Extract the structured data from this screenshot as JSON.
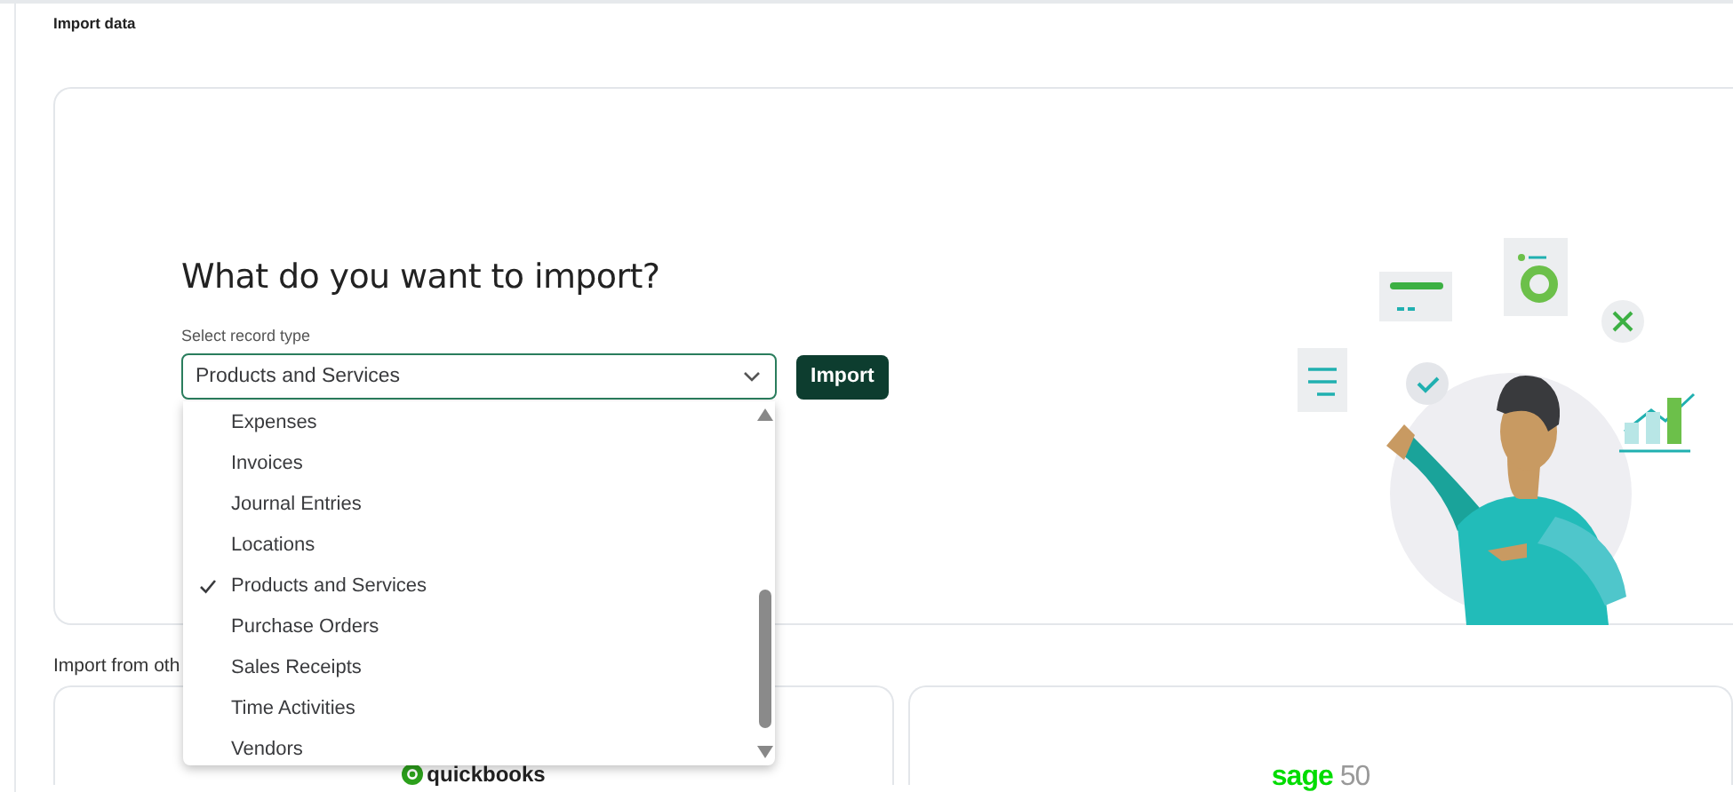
{
  "page": {
    "title": "Import data"
  },
  "import_panel": {
    "heading": "What do you want to import?",
    "field_label": "Select record type",
    "select": {
      "value": "Products and Services",
      "expanded": true
    },
    "button": "Import"
  },
  "dropdown": {
    "options": [
      {
        "label": "Expenses",
        "selected": false
      },
      {
        "label": "Invoices",
        "selected": false
      },
      {
        "label": "Journal Entries",
        "selected": false
      },
      {
        "label": "Locations",
        "selected": false
      },
      {
        "label": "Products and Services",
        "selected": true
      },
      {
        "label": "Purchase Orders",
        "selected": false
      },
      {
        "label": "Sales Receipts",
        "selected": false
      },
      {
        "label": "Time Activities",
        "selected": false
      },
      {
        "label": "Vendors",
        "selected": false
      }
    ]
  },
  "other_sources": {
    "heading": "Import from oth",
    "cards": [
      {
        "kind": "quickbooks",
        "logo_text": "quickbooks"
      },
      {
        "kind": "sage",
        "logo_text": "sage",
        "logo_suffix": "50"
      }
    ]
  }
}
